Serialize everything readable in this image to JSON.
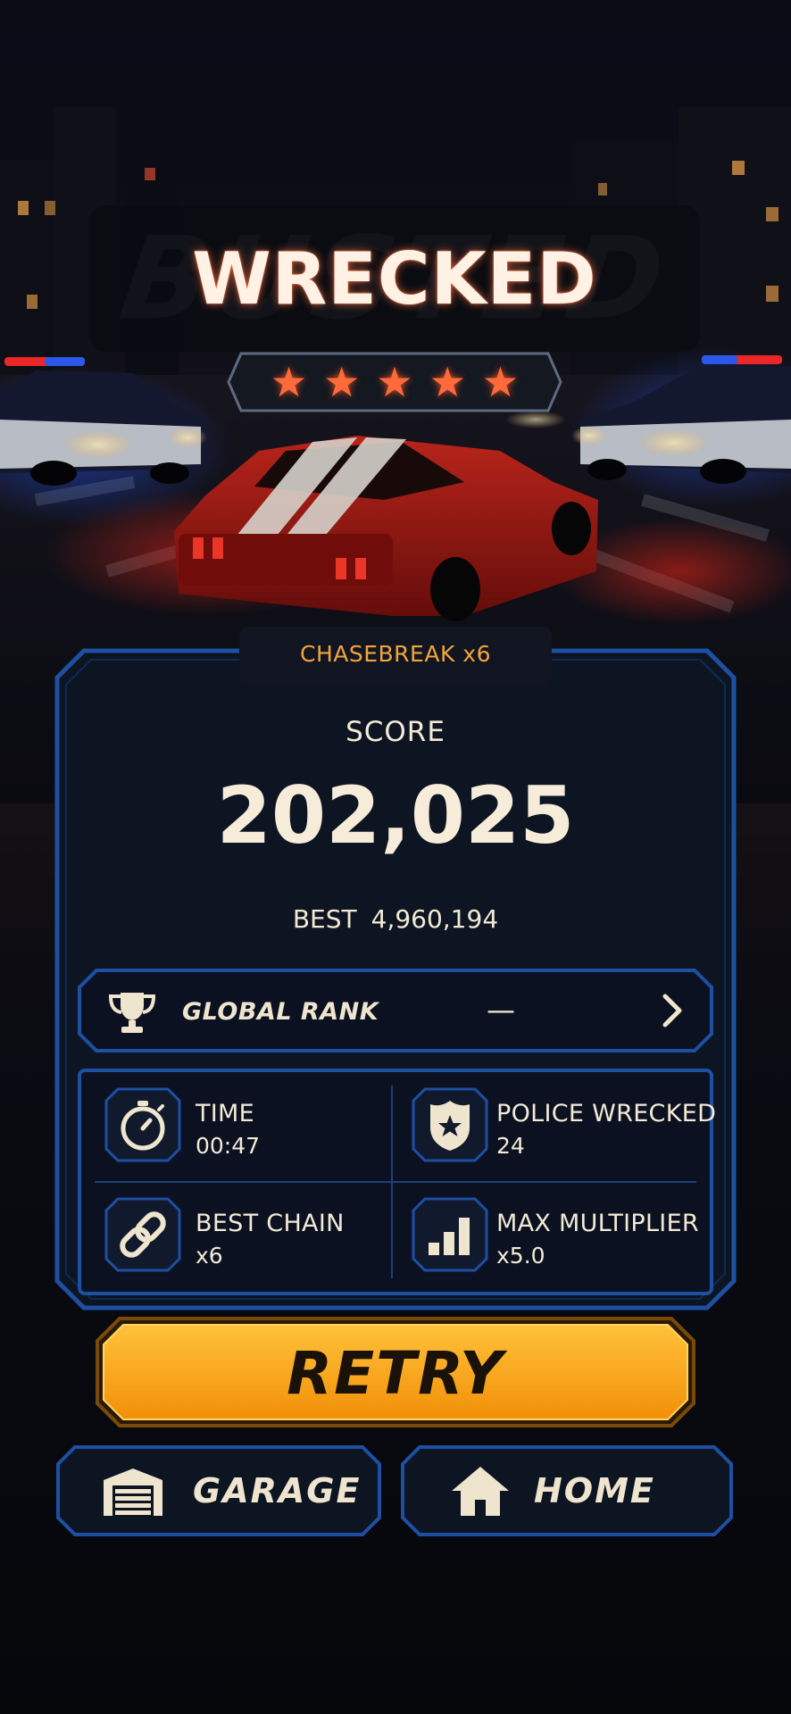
{
  "header": {
    "title": "WRECKED",
    "watermark": "BUSTED",
    "stars": [
      "★",
      "★",
      "★",
      "★",
      "★"
    ],
    "accent_color": "#ff6a3a"
  },
  "results": {
    "chain_badge": "CHASEBREAK x6",
    "score_label": "SCORE",
    "score_value": "202,025",
    "best_label": "BEST",
    "best_value": "4,960,194"
  },
  "global_rank": {
    "label": "GLOBAL RANK",
    "value": "—",
    "icon": "trophy-icon"
  },
  "stats": [
    {
      "title": "TIME",
      "value": "00:47",
      "icon": "stopwatch-icon"
    },
    {
      "title": "POLICE WRECKED",
      "value": "24",
      "icon": "police-badge-icon"
    },
    {
      "title": "BEST CHAIN",
      "value": "x6",
      "icon": "chain-link-icon"
    },
    {
      "title": "MAX MULTIPLIER",
      "value": "x5.0",
      "icon": "signal-bars-icon"
    }
  ],
  "buttons": {
    "retry_label": "RETRY",
    "garage_label": "GARAGE",
    "home_label": "HOME"
  },
  "colors": {
    "panel_border": "#1d4fa3",
    "retry_fill": "#f6a712",
    "chain_text": "#f2a43a"
  }
}
